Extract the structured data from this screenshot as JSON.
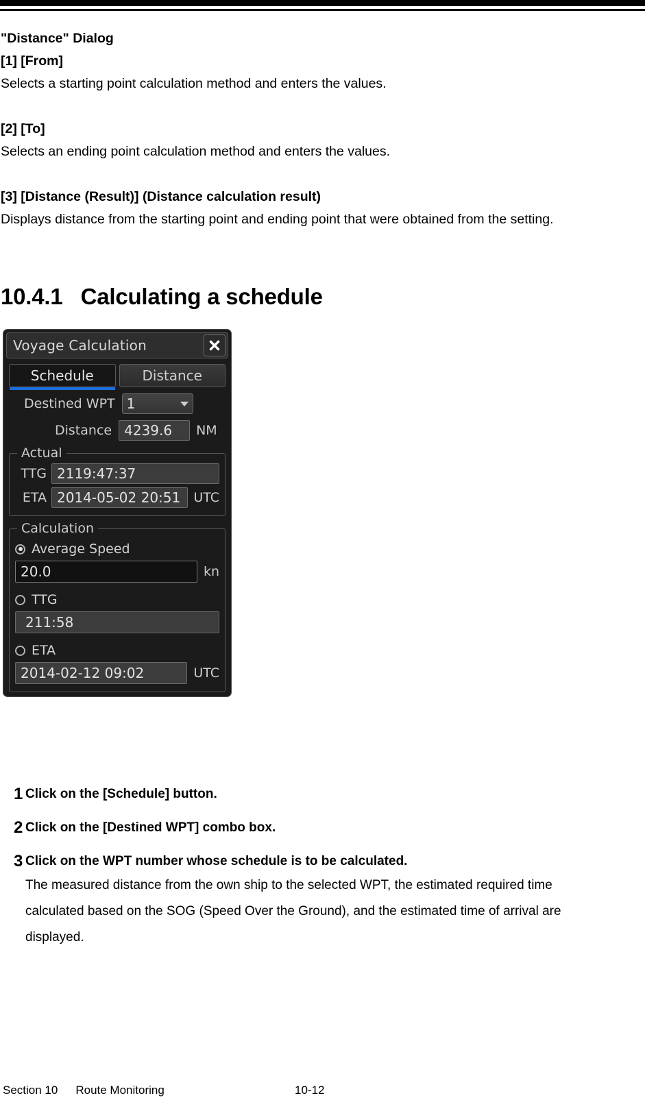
{
  "document": {
    "blocks": [
      {
        "id": "b1",
        "text": "\"Distance\" Dialog",
        "bold": true
      },
      {
        "id": "b2",
        "text": "[1] [From]",
        "bold": true
      },
      {
        "id": "b3",
        "text": "Selects a starting point calculation method and enters the values.",
        "bold": false
      },
      {
        "id": "b4",
        "text": "[2] [To]",
        "bold": true
      },
      {
        "id": "b5",
        "text": "Selects an ending point calculation method and enters the values.",
        "bold": false
      },
      {
        "id": "b6",
        "text": "[3] [Distance (Result)] (Distance calculation result)",
        "bold": true
      },
      {
        "id": "b7",
        "text": "Displays distance from the starting point and ending point that were obtained from the setting.",
        "bold": false
      }
    ],
    "section_heading": {
      "number": "10.4.1",
      "title": "Calculating a schedule"
    }
  },
  "dialog": {
    "title": "Voyage Calculation",
    "close_icon": "close-icon",
    "accent_color": "#1a6fe0",
    "tabs": [
      {
        "label": "Schedule",
        "active": true
      },
      {
        "label": "Distance",
        "active": false
      }
    ],
    "destined_wpt": {
      "label": "Destined WPT",
      "value": "1",
      "caret_icon": "chevron-down-icon"
    },
    "distance": {
      "label": "Distance",
      "value": "4239.6",
      "unit": "NM"
    },
    "actual_group": {
      "legend": "Actual",
      "rows": [
        {
          "label": "TTG",
          "value": "2119:47:37",
          "unit": ""
        },
        {
          "label": "ETA",
          "value": "2014-05-02 20:51",
          "unit": "UTC"
        }
      ]
    },
    "calculation_group": {
      "legend": "Calculation",
      "options": [
        {
          "label": "Average Speed",
          "selected": true,
          "value": "20.0",
          "unit": "kn",
          "editable": true
        },
        {
          "label": "TTG",
          "selected": false,
          "value": "211:58",
          "unit": "",
          "editable": false
        },
        {
          "label": "ETA",
          "selected": false,
          "value": "2014-02-12 09:02",
          "unit": "UTC",
          "editable": false
        }
      ]
    }
  },
  "steps": [
    {
      "num": "1",
      "title": "Click on the [Schedule] button.",
      "paras": []
    },
    {
      "num": "2",
      "title": "Click on the [Destined WPT] combo box.",
      "paras": []
    },
    {
      "num": "3",
      "title": "Click on the WPT number whose schedule is to be calculated.",
      "paras": [
        "The measured distance from the own ship to the selected WPT, the estimated required time",
        "calculated based on the SOG (Speed Over the Ground), and the estimated time of arrival are",
        "displayed."
      ]
    }
  ],
  "footer": {
    "section": "Section 10",
    "chapter": "Route Monitoring",
    "page": "10-12"
  }
}
